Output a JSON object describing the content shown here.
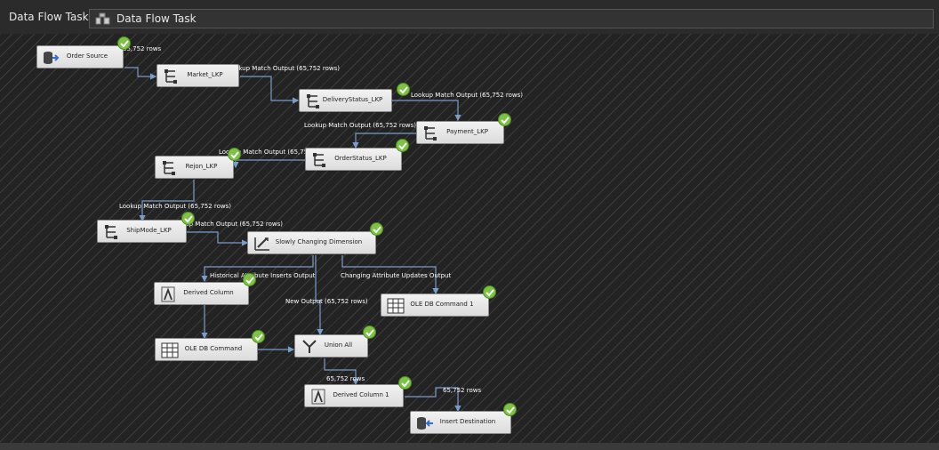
{
  "toolbar": {
    "label": "Data Flow Task:",
    "selected_task": "Data Flow Task",
    "task_icon": "data-flow-task-icon"
  },
  "components": {
    "order_source": {
      "label": "Order Source",
      "icon": "source-icon"
    },
    "market_lkp": {
      "label": "Market_LKP",
      "icon": "lookup-icon"
    },
    "deliverystatus_lkp": {
      "label": "DeliveryStatus_LKP",
      "icon": "lookup-icon"
    },
    "payment_lkp": {
      "label": "Payment_LKP",
      "icon": "lookup-icon"
    },
    "orderstatus_lkp": {
      "label": "OrderStatus_LKP",
      "icon": "lookup-icon"
    },
    "rejon_lkp": {
      "label": "Rejon_LKP",
      "icon": "lookup-icon"
    },
    "shipmode_lkp": {
      "label": "ShipMode_LKP",
      "icon": "lookup-icon"
    },
    "scd": {
      "label": "Slowly Changing Dimension",
      "icon": "scd-icon"
    },
    "derived_column": {
      "label": "Derived Column",
      "icon": "derived-column-icon"
    },
    "ole_db_command_1": {
      "label": "OLE DB Command 1",
      "icon": "ole-db-command-icon"
    },
    "ole_db_command": {
      "label": "OLE DB Command",
      "icon": "ole-db-command-icon"
    },
    "union_all": {
      "label": "Union All",
      "icon": "union-all-icon"
    },
    "derived_column_1": {
      "label": "Derived Column 1",
      "icon": "derived-column-icon"
    },
    "insert_destination": {
      "label": "Insert Destination",
      "icon": "destination-icon"
    }
  },
  "paths": {
    "p_source": "65,752 rows",
    "p_market": "Lookup Match Output (65,752 rows)",
    "p_delivery": "Lookup Match Output (65,752 rows)",
    "p_payment": "Lookup Match Output (65,752 rows)",
    "p_orderstatus": "Lookup Match Output (65,752 rows)",
    "p_rejon": "Lookup Match Output (65,752 rows)",
    "p_shipmode": "Lookup Match Output (65,752 rows)",
    "p_historical": "Historical Attribute Inserts Output",
    "p_changing": "Changing Attribute Updates Output",
    "p_new": "New Output (65,752 rows)",
    "p_union": "65,752 rows",
    "p_derived1": "65,752 rows"
  },
  "status": {
    "success_icon": "success-check-icon",
    "success_color": "#7cc243"
  },
  "colors": {
    "connector": "#7a9cc9",
    "canvas": "#232323",
    "node_fill": "#e6e6e6"
  }
}
